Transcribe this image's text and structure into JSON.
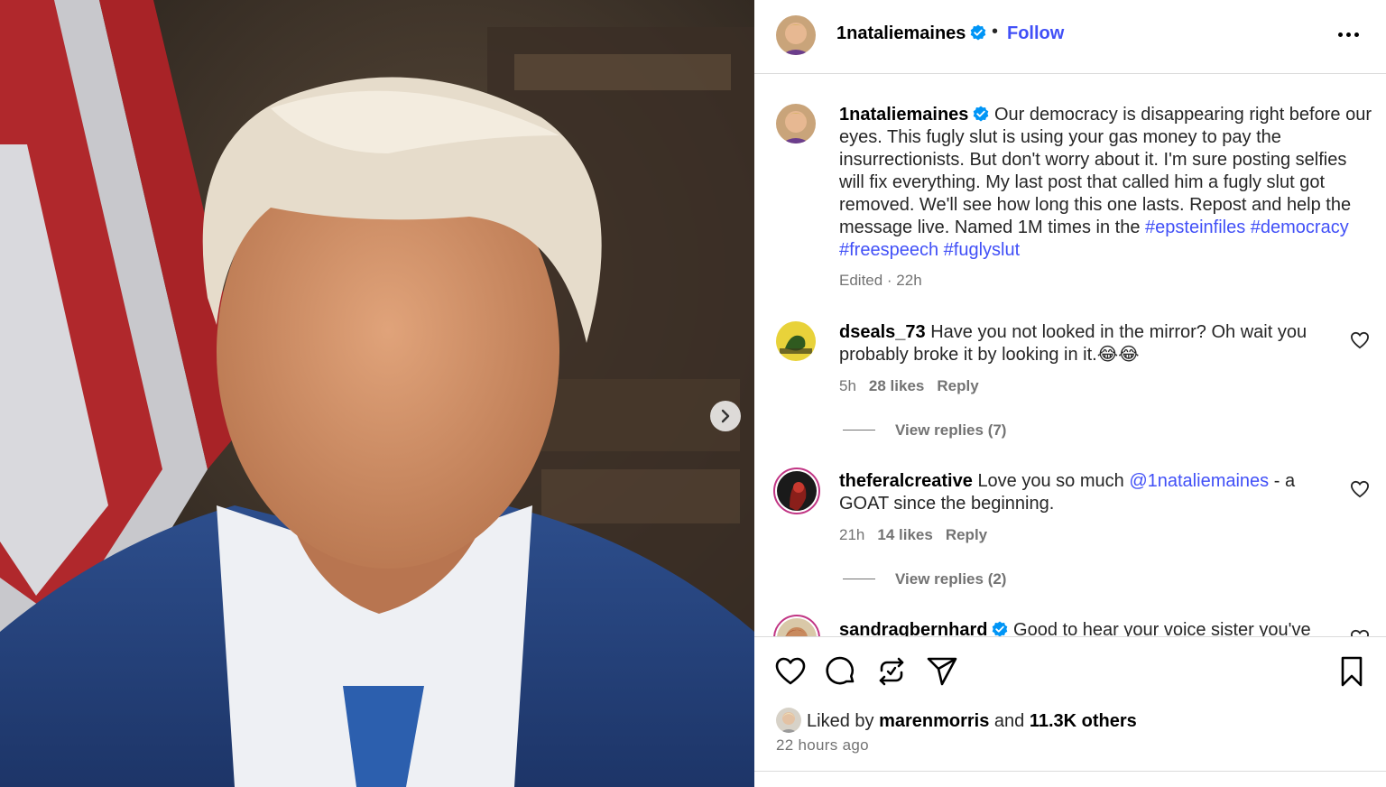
{
  "post": {
    "author": "1nataliemaines",
    "follow_label": "Follow",
    "separator": "•"
  },
  "caption": {
    "username": "1nataliemaines",
    "text": "Our democracy is disappearing right before our eyes. This fugly slut is using your gas money to pay the insurrectionists. But don't worry about it. I'm sure posting selfies will fix everything. My last post that called him a fugly slut got removed. We'll see how long this one lasts. Repost and help the message live. Named 1M times in the",
    "hashtags": [
      "#epsteinfiles",
      "#democracy",
      "#freespeech",
      "#fuglyslut"
    ],
    "meta": "Edited · 22h"
  },
  "comments": [
    {
      "username": "dseals_73",
      "text": "Have you not looked in the mirror? Oh wait you probably broke it by looking in it.😂😂",
      "time": "5h",
      "likes": "28 likes",
      "reply_label": "Reply",
      "view_replies": "View replies (7)"
    },
    {
      "username": "theferalcreative",
      "text_before": "Love you so much",
      "mention": "@1nataliemaines",
      "text_after": "- a GOAT since the beginning.",
      "time": "21h",
      "likes": "14 likes",
      "reply_label": "Reply",
      "view_replies": "View replies (2)"
    },
    {
      "username": "sandragbernhard",
      "text": "Good to hear your voice sister you've"
    }
  ],
  "footer": {
    "liked_prefix": "Liked by",
    "liked_user": "marenmorris",
    "liked_and": "and",
    "liked_others": "11.3K others",
    "time_ago": "22 hours ago"
  },
  "icons": {
    "like": "heart-icon",
    "comment": "comment-icon",
    "repost": "repost-icon",
    "share": "share-icon",
    "save": "bookmark-icon",
    "more": "more-icon",
    "next": "chevron-right-icon"
  },
  "colors": {
    "link_blue": "#4150f7",
    "verified_blue": "#0095f6",
    "muted_text": "#737373",
    "divider": "#dbdbdb"
  }
}
